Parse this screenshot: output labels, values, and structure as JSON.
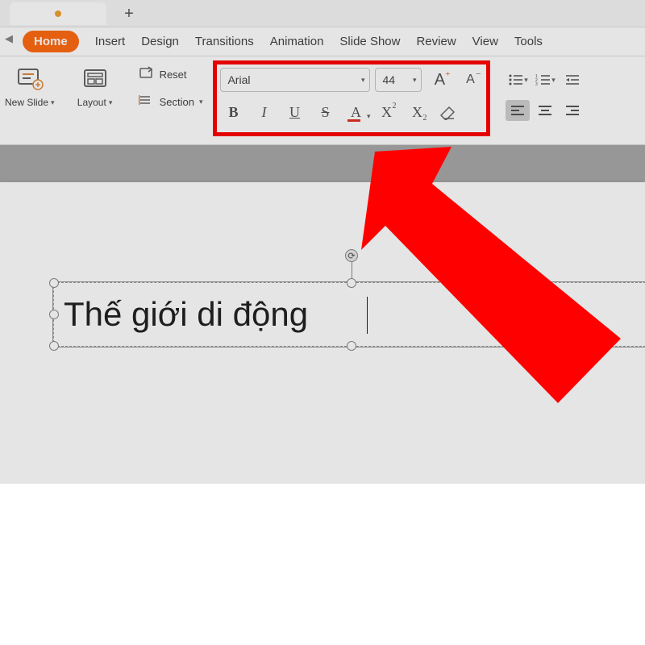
{
  "tabstrip": {
    "unsaved": true,
    "newtab_symbol": "+"
  },
  "ribbon_tabs": {
    "items": [
      "Home",
      "Insert",
      "Design",
      "Transitions",
      "Animation",
      "Slide Show",
      "Review",
      "View",
      "Tools"
    ],
    "active": "Home"
  },
  "slide_group": {
    "new_slide_label": "New Slide",
    "layout_label": "Layout",
    "reset_label": "Reset",
    "section_label": "Section"
  },
  "font_group": {
    "font_name": "Arial",
    "font_size": "44",
    "grow_font_letter": "A",
    "shrink_font_letter": "A",
    "bold": "B",
    "italic": "I",
    "underline": "U",
    "strike": "S",
    "font_color_letter": "A",
    "superscript": "X",
    "subscript": "X",
    "clear_format": ""
  },
  "textbox": {
    "content": "Thế giới di động"
  },
  "colors": {
    "accent": "#ff6a13",
    "highlight_box": "#ff0000",
    "font_color_underline": "#e03020"
  }
}
